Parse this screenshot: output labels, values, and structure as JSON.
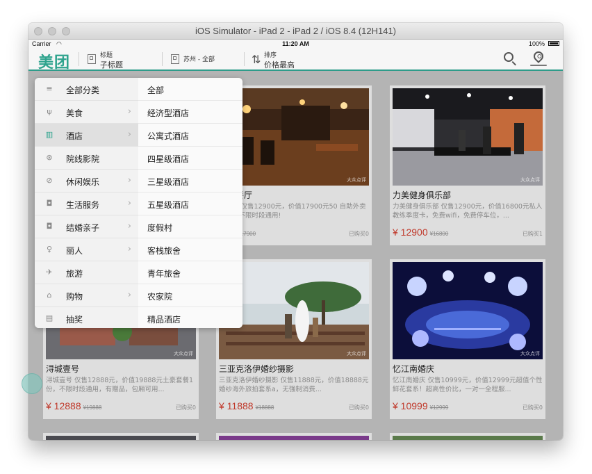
{
  "window": {
    "title": "iOS Simulator - iPad 2 - iPad 2 / iOS 8.4 (12H141)"
  },
  "status_bar": {
    "carrier": "Carrier",
    "time": "11:20 AM",
    "battery": "100%"
  },
  "nav": {
    "logo": "美团",
    "item1": {
      "small": "标题",
      "big": "子标题"
    },
    "item2": {
      "text": "苏州 - 全部"
    },
    "sort": {
      "small": "排序",
      "big": "价格最高"
    }
  },
  "popup": {
    "categories": [
      {
        "icon": "menu-icon",
        "label": "全部分类",
        "chevron": false
      },
      {
        "icon": "fork-knife-icon",
        "label": "美食",
        "chevron": true
      },
      {
        "icon": "hotel-icon",
        "label": "酒店",
        "chevron": true,
        "active": true
      },
      {
        "icon": "film-reel-icon",
        "label": "院线影院",
        "chevron": false
      },
      {
        "icon": "leisure-icon",
        "label": "休闲娱乐",
        "chevron": true
      },
      {
        "icon": "camera-icon",
        "label": "生活服务",
        "chevron": true
      },
      {
        "icon": "camera-icon",
        "label": "结婚亲子",
        "chevron": true
      },
      {
        "icon": "beauty-icon",
        "label": "丽人",
        "chevron": true
      },
      {
        "icon": "plane-icon",
        "label": "旅游",
        "chevron": false
      },
      {
        "icon": "bag-icon",
        "label": "购物",
        "chevron": true
      },
      {
        "icon": "gift-icon",
        "label": "抽奖",
        "chevron": false
      }
    ],
    "subcategories": [
      "全部",
      "经济型酒店",
      "公寓式酒店",
      "四星级酒店",
      "三星级酒店",
      "五星级酒店",
      "度假村",
      "客栈旅舍",
      "青年旅舍",
      "农家院",
      "精品酒店"
    ]
  },
  "cards": [
    {
      "name": "鱼西餐厅",
      "desc": "西餐厅 仅售12900元，价值17900元50\n自助外卖活动，不限时段通用!",
      "price": "900",
      "old": "¥17900",
      "sold": "已购买0"
    },
    {
      "name": "力美健身俱乐部",
      "desc": "力美健身俱乐部 仅售12900元，价值16800元私人教练季度卡，免费wifi，免费停车位，...",
      "price": "¥ 12900",
      "old": "¥16800",
      "sold": "已购买1"
    },
    {
      "name": "浔城壹号",
      "desc": "浔城壹号 仅售12888元，价值19888元土豪套餐1份，不限时段通用，有赠品，包厢可用...",
      "price": "¥ 12888",
      "old": "¥19888",
      "sold": "已购买0"
    },
    {
      "name": "三亚克洛伊婚纱摄影",
      "desc": "三亚克洛伊婚纱摄影 仅售11888元，价值18888元婚纱海外旅拍套系a，无强制消费...",
      "price": "¥ 11888",
      "old": "¥18888",
      "sold": "已购买0"
    },
    {
      "name": "忆江南婚庆",
      "desc": "忆江南婚庆 仅售10999元，价值12999元超值个性鲜花套系！超高性价比，一对一全程服...",
      "price": "¥ 10999",
      "old": "¥12999",
      "sold": "已购买0"
    }
  ],
  "colors": {
    "brand": "#2ea38d",
    "price": "#c0392b"
  }
}
